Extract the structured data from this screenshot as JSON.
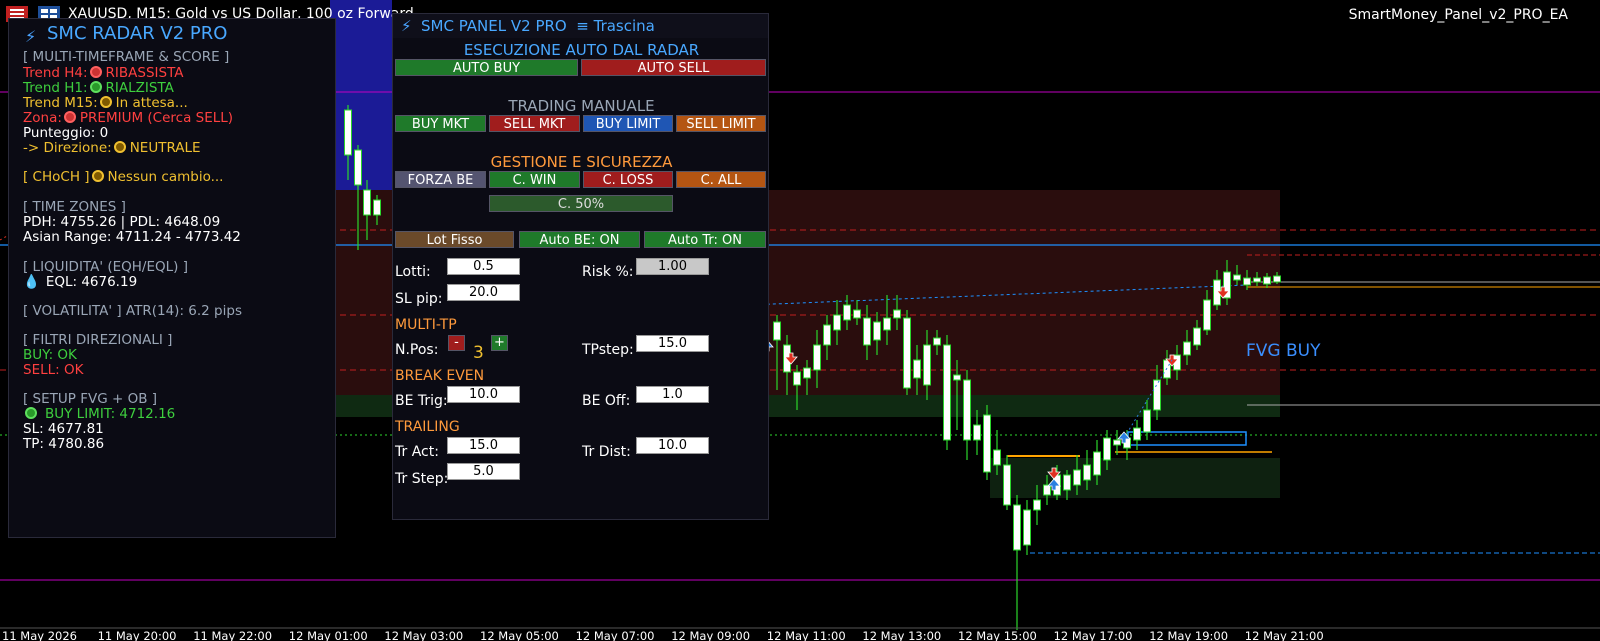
{
  "topbar": {
    "symbol_title": "XAUUSD, M15:  Gold vs US Dollar, 100 oz  Forward",
    "ea_name": "SmartMoney_Panel_v2_PRO_EA"
  },
  "chart": {
    "fvg_label": "FVG BUY",
    "x_ticks": [
      "11 May 2026",
      "11 May 20:00",
      "11 May 22:00",
      "12 May 01:00",
      "12 May 03:00",
      "12 May 05:00",
      "12 May 07:00",
      "12 May 09:00",
      "12 May 11:00",
      "12 May 13:00",
      "12 May 15:00",
      "12 May 17:00",
      "12 May 19:00",
      "12 May 21:00"
    ],
    "colors": {
      "background": "#000000",
      "bull": "#ffffff",
      "bear": "#000000",
      "wick": "#2bd62b",
      "magenta": "#c000c0",
      "blue_line": "#1e90ff"
    }
  },
  "radar": {
    "title": "SMC RADAR V2 PRO",
    "sec_mtf": "[ MULTI-TIMEFRAME & SCORE ]",
    "h4_label": "Trend H4:",
    "h4_value": "RIBASSISTA",
    "h1_label": "Trend H1:",
    "h1_value": "RIALZISTA",
    "m15_label": "Trend M15:",
    "m15_value": "In attesa...",
    "zona_label": "Zona:",
    "zona_value": "PREMIUM (Cerca SELL)",
    "score": "Punteggio: 0",
    "dir_label": "-> Direzione:",
    "dir_value": "NEUTRALE",
    "choch_label": "[ CHoCH ]",
    "choch_value": "Nessun cambio...",
    "sec_time": "[ TIME ZONES ]",
    "pdh": "PDH: 4755.26 | PDL: 4648.09",
    "asian": "Asian Range: 4711.24 - 4773.42",
    "sec_liq": "[ LIQUIDITA' (EQH/EQL) ]",
    "eql": "EQL: 4676.19",
    "volatility": "[ VOLATILITA' ] ATR(14): 6.2 pips",
    "sec_filters": "[ FILTRI DIREZIONALI ]",
    "buy_ok": "BUY: OK",
    "sell_ok": "SELL: OK",
    "sec_setup": "[ SETUP FVG + OB ]",
    "setup_value": "BUY LIMIT: 4712.16",
    "sl": "SL: 4677.81",
    "tp": "TP: 4780.86"
  },
  "panel": {
    "title": "SMC PANEL V2 PRO",
    "drag": "≡ Trascina",
    "sec_auto": "ESECUZIONE AUTO DAL RADAR",
    "auto_buy": "AUTO BUY",
    "auto_sell": "AUTO SELL",
    "sec_manual": "TRADING MANUALE",
    "buy_mkt": "BUY MKT",
    "sell_mkt": "SELL MKT",
    "buy_limit": "BUY LIMIT",
    "sell_limit": "SELL LIMIT",
    "sec_mgmt": "GESTIONE E SICUREZZA",
    "forza_be": "FORZA BE",
    "c_win": "C. WIN",
    "c_loss": "C. LOSS",
    "c_all": "C. ALL",
    "c_50": "C. 50%",
    "lot_fisso": "Lot Fisso",
    "auto_be": "Auto BE: ON",
    "auto_tr": "Auto Tr: ON",
    "lotti_label": "Lotti:",
    "lotti_value": "0.5",
    "risk_label": "Risk %:",
    "risk_value": "1.00",
    "sl_label": "SL pip:",
    "sl_value": "20.0",
    "sec_multitp": "MULTI-TP",
    "npos_label": "N.Pos:",
    "npos_minus": "-",
    "npos_value": "3",
    "npos_plus": "+",
    "tpstep_label": "TPstep:",
    "tpstep_value": "15.0",
    "sec_be": "BREAK EVEN",
    "betrig_label": "BE Trig:",
    "betrig_value": "10.0",
    "beoff_label": "BE Off:",
    "beoff_value": "1.0",
    "sec_trailing": "TRAILING",
    "tract_label": "Tr Act:",
    "tract_value": "15.0",
    "trdist_label": "Tr Dist:",
    "trdist_value": "10.0",
    "trstep_label": "Tr Step:",
    "trstep_value": "5.0"
  }
}
